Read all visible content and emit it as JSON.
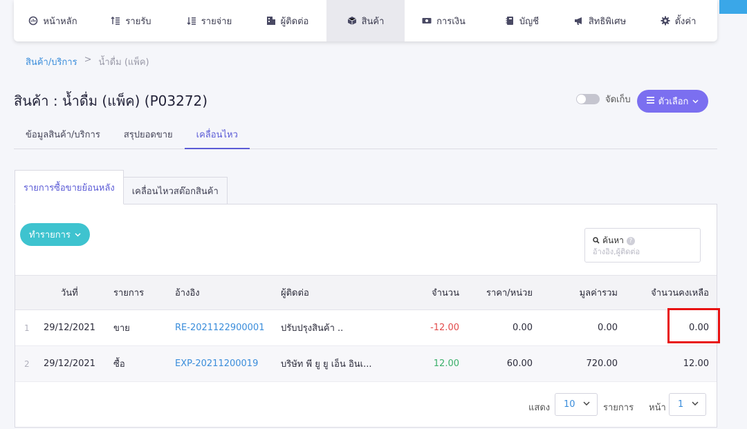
{
  "nav": [
    {
      "label": "หน้าหลัก",
      "icon": "dashboard-icon"
    },
    {
      "label": "รายรับ",
      "icon": "income-icon"
    },
    {
      "label": "รายจ่าย",
      "icon": "expense-icon"
    },
    {
      "label": "ผู้ติดต่อ",
      "icon": "contacts-icon"
    },
    {
      "label": "สินค้า",
      "icon": "box-icon",
      "active": true
    },
    {
      "label": "การเงิน",
      "icon": "money-icon"
    },
    {
      "label": "บัญชี",
      "icon": "ledger-icon"
    },
    {
      "label": "สิทธิพิเศษ",
      "icon": "megaphone-icon"
    },
    {
      "label": "ตั้งค่า",
      "icon": "gear-icon"
    }
  ],
  "breadcrumb": {
    "parent": "สินค้า/บริการ",
    "separator": ">",
    "current": "น้ำดื่ม (แพ็ค)"
  },
  "page": {
    "title": "สินค้า : น้ำดื่ม (แพ็ค) (P03272)"
  },
  "archive_toggle": {
    "label": "จัดเก็บ"
  },
  "options_button": {
    "label": "ตัวเลือก"
  },
  "subtabs": [
    "ข้อมูลสินค้า/บริการ",
    "สรุปยอดขาย",
    "เคลื่อนไหว"
  ],
  "panel_tabs": [
    "รายการซื้อขายย้อนหลัง",
    "เคลื่อนไหวสต๊อกสินค้า"
  ],
  "action_button": {
    "label": "ทำรายการ"
  },
  "search": {
    "label": "ค้นหา",
    "placeholder": "อ้างอิง,ผู้ติดต่อ"
  },
  "table": {
    "headers": [
      "วันที่",
      "รายการ",
      "อ้างอิง",
      "ผู้ติดต่อ",
      "จำนวน",
      "ราคา/หน่วย",
      "มูลค่ารวม",
      "จำนวนคงเหลือ"
    ],
    "rows": [
      {
        "no": "1",
        "date": "29/12/2021",
        "type": "ขาย",
        "ref": "RE-2021122900001",
        "contact": "ปรับปรุงสินค้า ..",
        "qty": "-12.00",
        "price": "0.00",
        "total": "0.00",
        "remaining": "0.00"
      },
      {
        "no": "2",
        "date": "29/12/2021",
        "type": "ซื้อ",
        "ref": "EXP-20211200019",
        "contact": "บริษัท พี ยู ยู เอ็น อินเ...",
        "qty": "12.00",
        "price": "60.00",
        "total": "720.00",
        "remaining": "12.00"
      }
    ]
  },
  "pagination": {
    "show_label": "แสดง",
    "per_page": "10",
    "items_label": "รายการ",
    "page_label": "หน้า",
    "page": "1"
  },
  "colors": {
    "accent": "#7b6ff0",
    "action": "#3ec3cf",
    "link": "#3a8ddb",
    "negative": "#e24b4b",
    "positive": "#3bb06a",
    "highlight": "#e81010"
  }
}
